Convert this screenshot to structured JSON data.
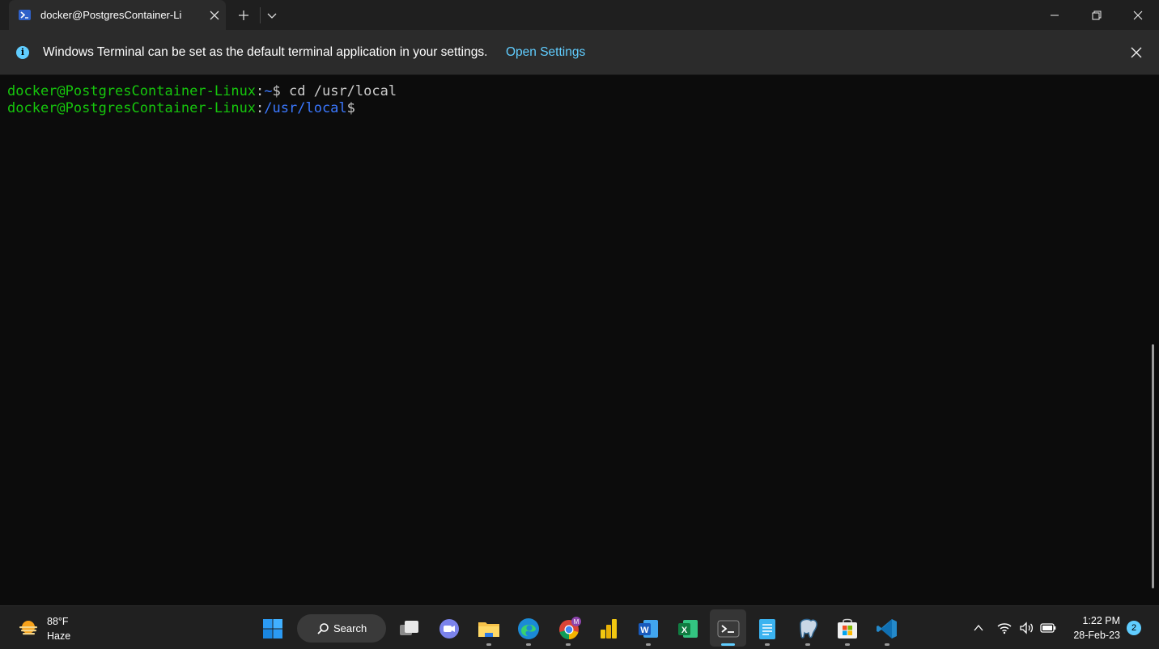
{
  "window": {
    "tab_title": "docker@PostgresContainer-Li",
    "icons": {
      "tab": "powershell-icon",
      "close_tab": "close-icon",
      "new_tab": "plus-icon",
      "dropdown": "chevron-down-icon",
      "minimize": "minimize-icon",
      "maximize": "restore-icon",
      "close": "close-icon"
    }
  },
  "infobar": {
    "icon": "info-icon",
    "icon_glyph": "i",
    "message": "Windows Terminal can be set as the default terminal application in your settings.",
    "link": "Open Settings",
    "dismiss_icon": "close-icon"
  },
  "terminal": {
    "colors": {
      "user_host": "#16c60c",
      "path": "#3b78ff",
      "text": "#cccccc",
      "background": "#0c0c0c"
    },
    "lines": [
      {
        "user_host": "docker@PostgresContainer-Linux",
        "colon": ":",
        "path": "~",
        "prompt": "$",
        "command": " cd /usr/local"
      },
      {
        "user_host": "docker@PostgresContainer-Linux",
        "colon": ":",
        "path": "/usr/local",
        "prompt": "$",
        "command": ""
      }
    ]
  },
  "taskbar": {
    "weather": {
      "temp": "88°F",
      "condition": "Haze",
      "icon": "haze-sun-icon"
    },
    "search_label": "Search",
    "apps": [
      {
        "name": "start",
        "icon": "windows-start-icon"
      },
      {
        "name": "task-view",
        "icon": "task-view-icon"
      },
      {
        "name": "teams-chat",
        "icon": "chat-icon"
      },
      {
        "name": "file-explorer",
        "icon": "folder-icon"
      },
      {
        "name": "edge",
        "icon": "edge-icon"
      },
      {
        "name": "chrome",
        "icon": "chrome-icon",
        "badge": "M"
      },
      {
        "name": "power-bi",
        "icon": "powerbi-icon"
      },
      {
        "name": "word",
        "icon": "word-icon"
      },
      {
        "name": "excel",
        "icon": "excel-icon"
      },
      {
        "name": "terminal",
        "icon": "terminal-icon",
        "active": true
      },
      {
        "name": "notepad",
        "icon": "notepad-icon"
      },
      {
        "name": "pgadmin",
        "icon": "postgres-elephant-icon"
      },
      {
        "name": "store",
        "icon": "store-icon"
      },
      {
        "name": "vscode",
        "icon": "vscode-icon"
      }
    ],
    "tray": {
      "time": "1:22 PM",
      "date": "28-Feb-23",
      "notifications": "2",
      "icons": [
        "chevron-up-icon",
        "wifi-icon",
        "volume-icon",
        "battery-icon"
      ]
    }
  }
}
